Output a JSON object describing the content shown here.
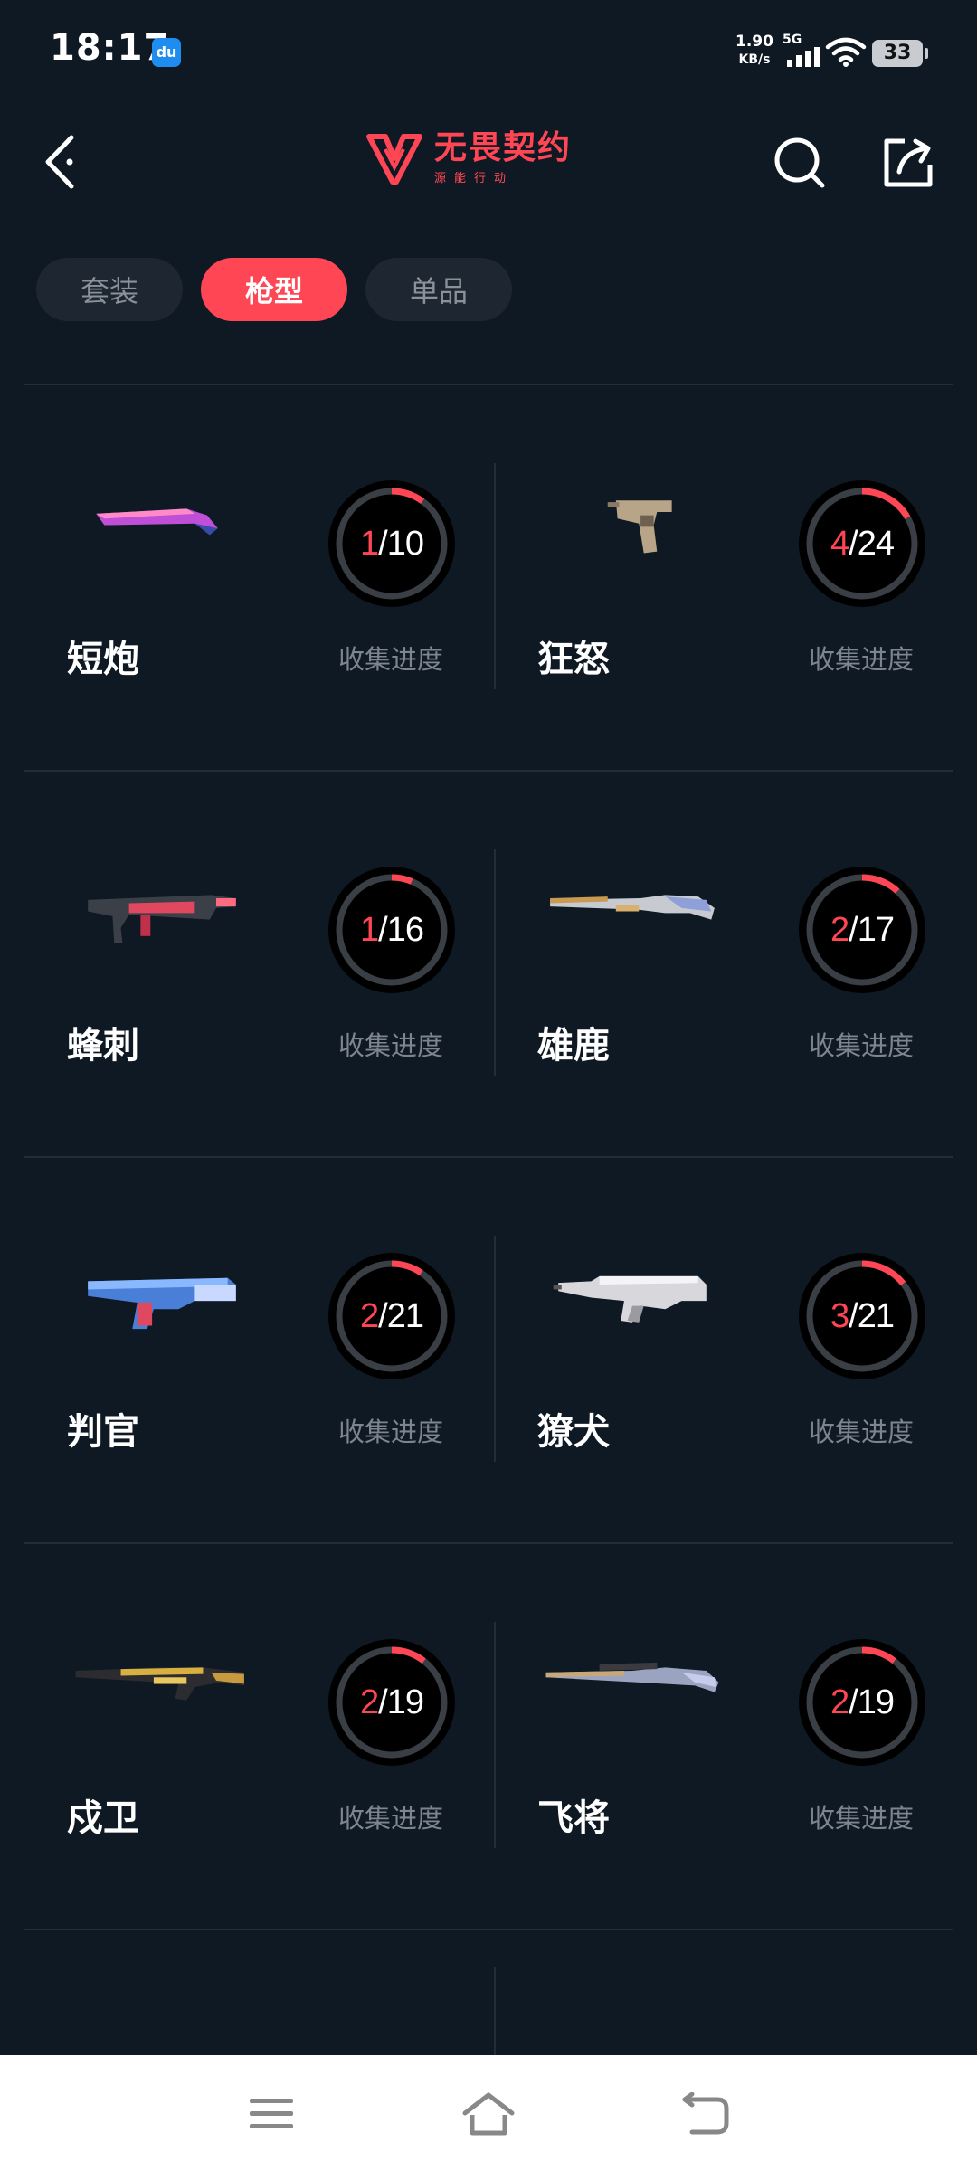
{
  "status_bar": {
    "time": "18:17",
    "app_badge": "du",
    "net_speed_value": "1.90",
    "net_speed_unit": "KB/s",
    "network": "5G",
    "battery": "33"
  },
  "app_bar": {
    "logo_title": "无畏契约",
    "logo_subtitle": "源能行动",
    "accent_color": "#ff4655"
  },
  "tabs": [
    {
      "label": "套装",
      "active": false
    },
    {
      "label": "枪型",
      "active": true
    },
    {
      "label": "单品",
      "active": false
    }
  ],
  "weapons": [
    {
      "name": "短炮",
      "collected": 1,
      "total": 10,
      "label": "收集进度",
      "icon": "shotgun-icon"
    },
    {
      "name": "狂怒",
      "collected": 4,
      "total": 24,
      "label": "收集进度",
      "icon": "machine-pistol-icon"
    },
    {
      "name": "蜂刺",
      "collected": 1,
      "total": 16,
      "label": "收集进度",
      "icon": "smg-icon"
    },
    {
      "name": "雄鹿",
      "collected": 2,
      "total": 17,
      "label": "收集进度",
      "icon": "pump-shotgun-icon"
    },
    {
      "name": "判官",
      "collected": 2,
      "total": 21,
      "label": "收集进度",
      "icon": "auto-shotgun-icon"
    },
    {
      "name": "獠犬",
      "collected": 3,
      "total": 21,
      "label": "收集进度",
      "icon": "bullpup-rifle-icon"
    },
    {
      "name": "戍卫",
      "collected": 2,
      "total": 19,
      "label": "收集进度",
      "icon": "semi-auto-rifle-icon"
    },
    {
      "name": "飞将",
      "collected": 2,
      "total": 19,
      "label": "收集进度",
      "icon": "lever-sniper-icon"
    }
  ],
  "nav_bar": [
    "menu-icon",
    "home-icon",
    "back-icon"
  ]
}
